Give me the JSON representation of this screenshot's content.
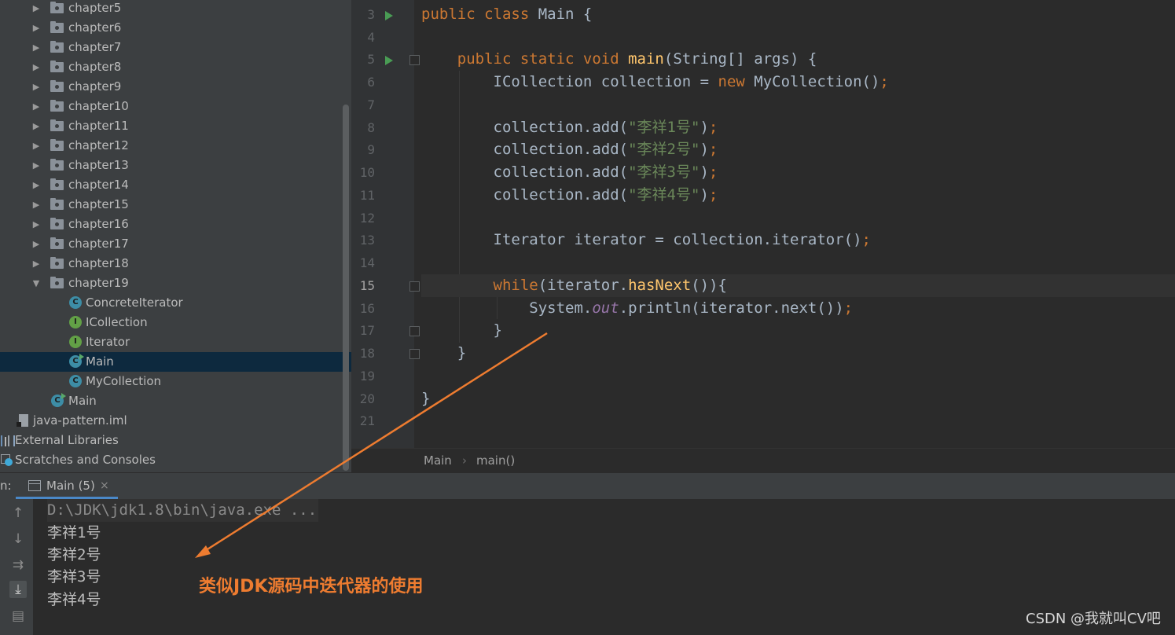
{
  "project_tree": {
    "folders": [
      "chapter5",
      "chapter6",
      "chapter7",
      "chapter8",
      "chapter9",
      "chapter10",
      "chapter11",
      "chapter12",
      "chapter13",
      "chapter14",
      "chapter15",
      "chapter16",
      "chapter17",
      "chapter18"
    ],
    "open_folder": "chapter19",
    "children": [
      {
        "name": "ConcreteIterator",
        "kind": "class",
        "icon": "class-icon"
      },
      {
        "name": "ICollection",
        "kind": "interface",
        "icon": "interface-icon"
      },
      {
        "name": "Iterator",
        "kind": "interface",
        "icon": "interface-icon"
      },
      {
        "name": "Main",
        "kind": "main-class",
        "icon": "runnable-class-icon",
        "selected": true
      },
      {
        "name": "MyCollection",
        "kind": "class",
        "icon": "class-icon"
      }
    ],
    "root_main": "Main",
    "iml_file": "java-pattern.iml",
    "external_libraries": "External Libraries",
    "scratches": "Scratches and Consoles"
  },
  "editor": {
    "line_numbers": [
      "3",
      "4",
      "5",
      "6",
      "7",
      "8",
      "9",
      "10",
      "11",
      "12",
      "13",
      "14",
      "15",
      "16",
      "17",
      "18",
      "19",
      "20",
      "21"
    ],
    "current_line": "15",
    "code": {
      "l3": {
        "kw": "public class ",
        "name": "Main",
        "rest": " {"
      },
      "l5": {
        "kw": "public static void ",
        "fn": "main",
        "rest": "(String[] args) {"
      },
      "l6": {
        "a": "ICollection collection = ",
        "kw": "new ",
        "b": "MyCollection()",
        "semi": ";"
      },
      "l8": {
        "a": "collection.add(",
        "str": "\"李祥1号\"",
        "b": ")",
        "semi": ";"
      },
      "l9": {
        "a": "collection.add(",
        "str": "\"李祥2号\"",
        "b": ")",
        "semi": ";"
      },
      "l10": {
        "a": "collection.add(",
        "str": "\"李祥3号\"",
        "b": ")",
        "semi": ";"
      },
      "l11": {
        "a": "collection.add(",
        "str": "\"李祥4号\"",
        "b": ")",
        "semi": ";"
      },
      "l13": {
        "a": "Iterator iterator = collection.iterator()",
        "semi": ";"
      },
      "l15": {
        "kw": "while",
        "a": "(iterator.",
        "fn": "hasNext",
        "b": "()){"
      },
      "l16": {
        "a": "System.",
        "fld": "out",
        "b": ".println(iterator.next())",
        "semi": ";"
      },
      "l17": {
        "a": "}"
      },
      "l18": {
        "a": "}"
      },
      "l20": {
        "a": "}"
      }
    }
  },
  "breadcrumb": {
    "class": "Main",
    "method": "main()",
    "separator": "›"
  },
  "run_panel": {
    "label": "n:",
    "tab_label": "Main (5)",
    "close_glyph": "×"
  },
  "console": {
    "command": "D:\\JDK\\jdk1.8\\bin\\java.exe ...",
    "output": [
      "李祥1号",
      "李祥2号",
      "李祥3号",
      "李祥4号"
    ],
    "tools": [
      "up-arrow-icon",
      "down-arrow-icon",
      "soft-wrap-icon",
      "scroll-to-end-icon",
      "print-icon"
    ]
  },
  "annotation": {
    "text": "类似JDK源码中迭代器的使用",
    "color": "#ee7c30"
  },
  "watermark": "CSDN @我就叫CV吧",
  "colors": {
    "keyword": "#cc7832",
    "string": "#6a8759",
    "function": "#ffc66d",
    "field": "#9876aa",
    "selection": "#0d293e",
    "accent": "#4a88c7"
  }
}
